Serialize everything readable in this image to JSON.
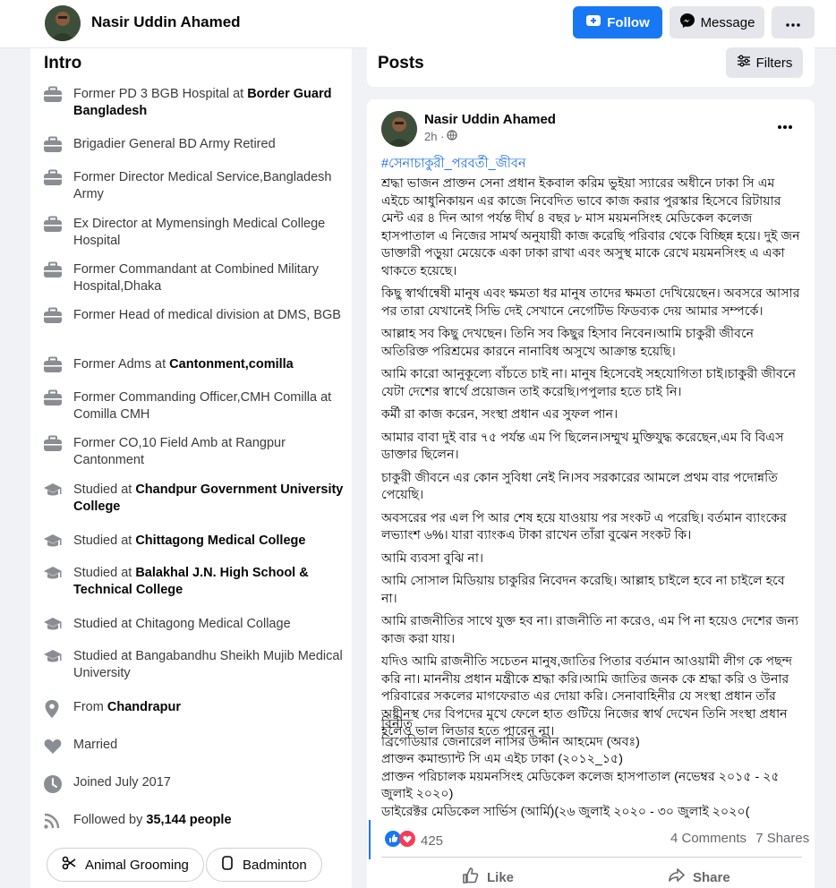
{
  "header": {
    "name": "Nasir Uddin Ahamed",
    "follow_label": "Follow",
    "message_label": "Message"
  },
  "intro": {
    "title": "Intro",
    "items": [
      {
        "icon": "briefcase-icon",
        "prefix": "Former PD 3 BGB Hospital at ",
        "bold": "Border Guard Bangladesh"
      },
      {
        "icon": "briefcase-icon",
        "prefix": "Brigadier General BD Army Retired",
        "bold": ""
      },
      {
        "icon": "briefcase-icon",
        "prefix": "Former Director Medical Service,Bangladesh Army",
        "bold": ""
      },
      {
        "icon": "briefcase-icon",
        "prefix": "Ex Director at Mymensingh Medical College Hospital",
        "bold": ""
      },
      {
        "icon": "briefcase-icon",
        "prefix": "Former Commandant at Combined Military Hospital,Dhaka",
        "bold": ""
      },
      {
        "icon": "briefcase-icon",
        "prefix": "Former Head of medical division at DMS, BGB",
        "bold": ""
      },
      {
        "icon": "briefcase-icon",
        "prefix": "Former Adms at ",
        "bold": "Cantonment,comilla"
      },
      {
        "icon": "briefcase-icon",
        "prefix": "Former Commanding Officer,CMH Comilla at Comilla CMH",
        "bold": ""
      },
      {
        "icon": "briefcase-icon",
        "prefix": "Former CO,10 Field Amb at Rangpur Cantonment",
        "bold": ""
      },
      {
        "icon": "graduation-cap-icon",
        "prefix": "Studied at ",
        "bold": "Chandpur Government University College"
      },
      {
        "icon": "graduation-cap-icon",
        "prefix": "Studied at ",
        "bold": "Chittagong Medical College"
      },
      {
        "icon": "graduation-cap-icon",
        "prefix": "Studied at ",
        "bold": "Balakhal J.N. High School & Technical College"
      },
      {
        "icon": "graduation-cap-icon",
        "prefix": "Studied at Chitagong Medical Collage",
        "bold": ""
      },
      {
        "icon": "graduation-cap-icon",
        "prefix": "Studied at Bangabandhu Sheikh Mujib Medical University",
        "bold": ""
      },
      {
        "icon": "location-pin-icon",
        "prefix": "From ",
        "bold": "Chandrapur"
      },
      {
        "icon": "heart-icon",
        "prefix": "Married",
        "bold": ""
      },
      {
        "icon": "clock-icon",
        "prefix": "Joined July 2017",
        "bold": ""
      },
      {
        "icon": "rss-icon",
        "prefix": "Followed by ",
        "bold": "35,144 people"
      }
    ],
    "hobbies": [
      {
        "icon": "scissors-icon",
        "label": "Animal Grooming"
      },
      {
        "icon": "shuttlecock-icon",
        "label": "Badminton"
      }
    ]
  },
  "posts": {
    "title": "Posts",
    "filters_label": "Filters"
  },
  "post": {
    "author": "Nasir Uddin Ahamed",
    "time": "2h ·",
    "hashtag": "#সেনাচাকুরী_পরবর্তী_জীবন",
    "paragraphs": [
      "শ্রদ্ধা ভাজন প্রাক্তন সেনা প্রধান ইকবাল করিম ভুইয়া স্যারের অধীনে ঢাকা সি এম এইচে আধুনিকায়ন এর কাজে নিবেদিত ভাবে কাজ করার পুরস্কার হিসেবে রিটায়ার মেন্ট এর ৪ দিন আগ পর্যন্ত দীর্ঘ ৪ বছর ৮ মাস ময়মনসিংহ মেডিকেল কলেজ হাসপাতাল এ নিজের সামর্থ অনুযায়ী কাজ করেছি পরিবার থেকে বিচ্ছিন্ন হয়ে। দুই জন ডাক্তারী পড়ুয়া মেয়েকে একা ঢাকা রাখা এবং অসুস্থ মাকে রেখে ময়মনসিংহ এ একা থাকতে হয়েছে।",
      "কিছু স্বার্থান্বেষী মানুষ এবং ক্ষমতা ধর মানুষ তাদের ক্ষমতা দেখিয়েছেন। অবসরে আসার পর তারা যেখানেই সিভি দেই সেখানে নেগেটিভ  ফিডব্যক দেয় আমার সম্পর্কে।",
      "আল্লাহ সব কিছু দেখছেন। তিনি সব কিছুর হিসাব নিবেন।আমি চাকুরী জীবনে অতিরিক্ত পরিশ্রমের কারনে নানাবিধ অসুখে আক্রান্ত হয়েছি।",
      "আমি কারো আনুকূল্যে বাঁচতে চাই না। মানুষ হিসেবেই সহযোগিতা চাই।চাকুরী জীবনে যেটা দেশের স্বার্থে প্রয়োজন তাই করেছি।পপুলার হতে চাই নি।",
      "কর্মী রা কাজ করেন, সংস্থা প্রধান এর সুফল পান।",
      "আমার বাবা দুই বার ৭৫ পর্যন্ত এম পি ছিলেন।সম্মুখ মুক্তিযুদ্ধ করেছেন,এম বি বিএস ডাক্তার ছিলেন।",
      "চাকুরী জীবনে এর কোন সুবিধা নেই নি।সব সরকারের আমলে প্রথম বার পদোন্নতি পেয়েছি।",
      "অবসরের পর এল পি আর শেষ হয়ে যাওয়ায় পর সংকট এ পরেছি। বর্তমান ব্যাংকের লভ্যাংশ ৬%। যারা ব্যাংকএ টাকা রাখেন তাঁরা বুঝেন সংকট কি।",
      "আমি ব্যবসা বুঝি না।",
      "আমি সোসাল মিডিয়ায় চাকুরির নিবেদন করেছি। আল্লাহ চাইলে হবে না চাইলে হবে না।",
      "আমি রাজনীতির সাথে যুক্ত হব না। রাজনীতি না করেও, এম পি না হয়েও দেশের জন্য কাজ করা যায়।",
      "যদিও আমি রাজনীতি সচেতন মানুষ,জাতির পিতার বর্তমান আওয়ামী লীগ কে পছন্দ করি না। মাননীয় প্রধান মন্ত্রীকে শ্রদ্ধা করি।আমি জাতির জনক কে শ্রদ্ধা করি ও উনার পরিবারের সকলের  মাগফেরাত এর দোয়া করি। সেনাবাহিনীর যে সংস্থা প্রধান তাঁর অধীনস্থ দের বিপদের মুখে ফেলে হাত গুটিয়ে নিজের স্বার্থ দেখেন তিনি সংস্থা প্রধান হলেও ভাল লিডার হতে পারেন না।"
    ],
    "signature": [
      "বিনীত",
      "ব্রিগেডিয়ার জেনারেল নাসির উদ্দীন আহমেদ (অবঃ)",
      "প্রাক্তন কমান্ড্যান্ট সি এম এইচ ঢাকা (২০১২_১৫)",
      "প্রাক্তন পরিচালক ময়মনসিংহ মেডিকেল কলেজ হাসপাতাল (নভেম্বর ২০১৫ - ২৫ জুলাই ২০২০)",
      "ডাইরেক্টর মেডিকেল সার্ভিস (আর্মি)(২৬ জুলাই ২০২০ - ৩০ জুলাই ২০২০("
    ],
    "reactions_count": "425",
    "comments_label": "4 Comments",
    "shares_label": "7 Shares",
    "like_label": "Like",
    "share_label": "Share"
  },
  "colors": {
    "accent": "#1877f2",
    "love": "#f33e58"
  }
}
